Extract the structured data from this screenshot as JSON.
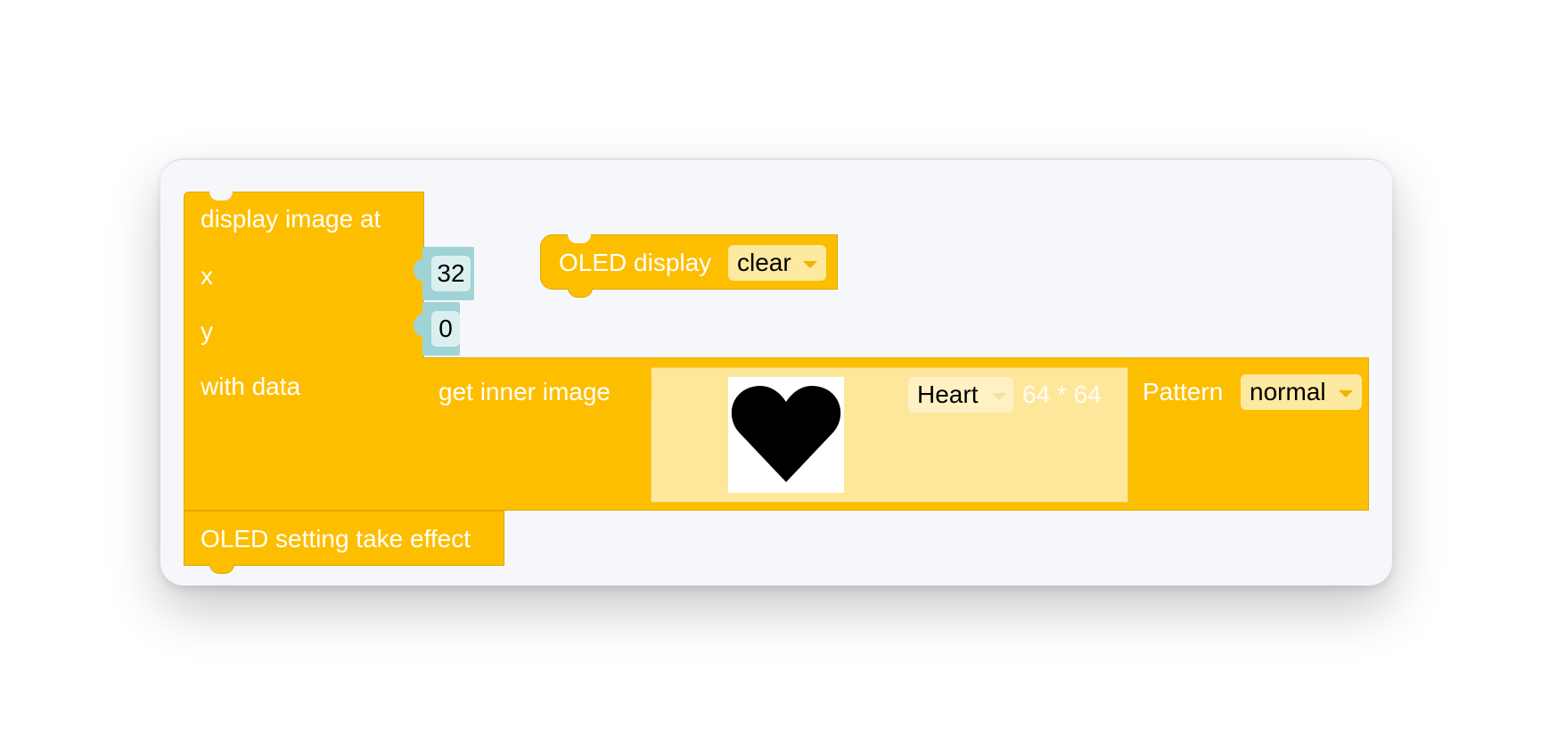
{
  "blocks": {
    "display_image": {
      "title": "display image at",
      "x_label": "x",
      "y_label": "y",
      "data_label": "with data",
      "x_value": "32",
      "y_value": "0"
    },
    "oled_display": {
      "label": "OLED display",
      "mode_value": "clear"
    },
    "get_inner_image": {
      "label": "get inner image",
      "image_name": "Heart",
      "image_size": "64 * 64",
      "pattern_label": "Pattern",
      "pattern_value": "normal",
      "image_icon": "heart-icon"
    },
    "oled_effect": {
      "label": "OLED setting take effect"
    }
  },
  "colors": {
    "block": "#fdbe00",
    "number_block": "#9fd3d6",
    "image_panel": "#fee79a",
    "workspace": "#f6f7fb"
  }
}
